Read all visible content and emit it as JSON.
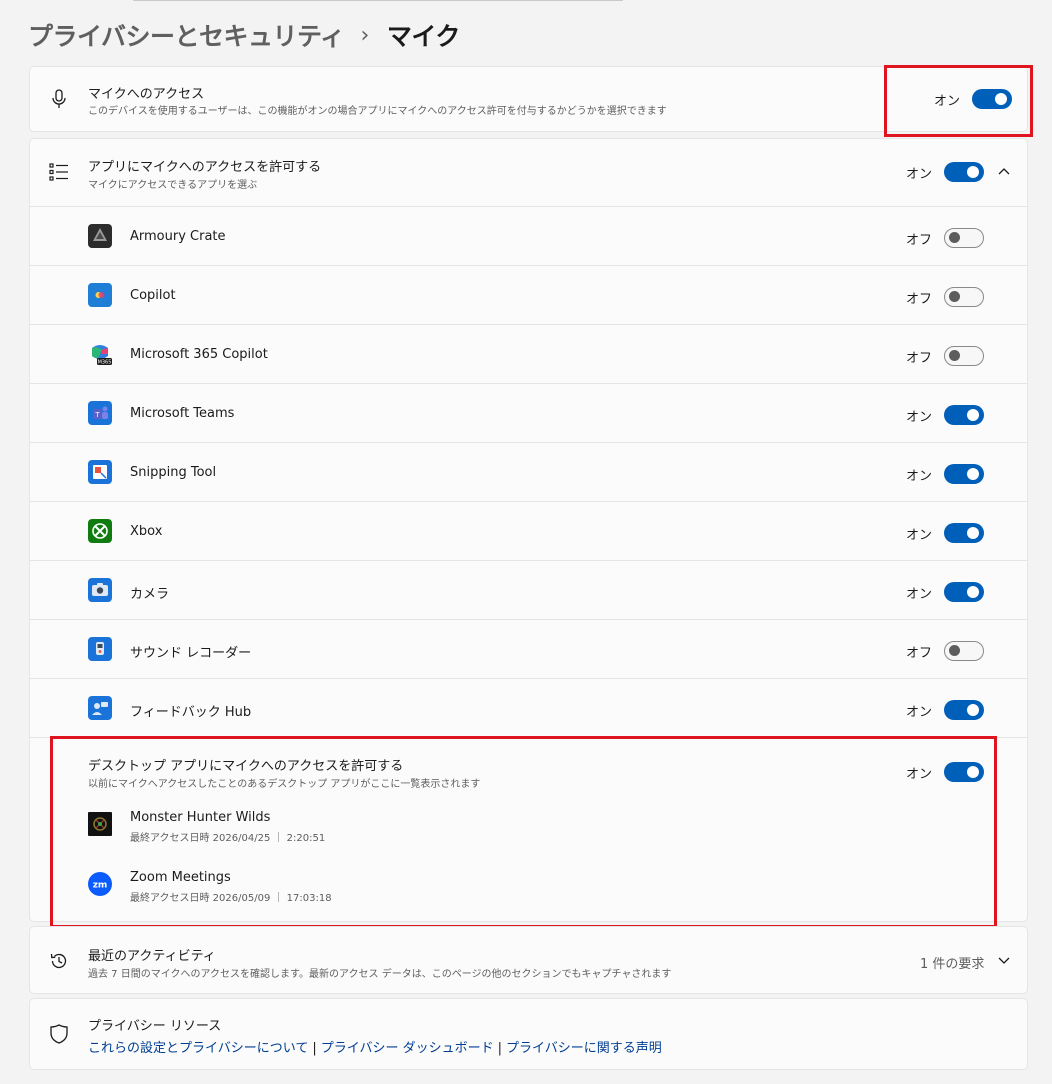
{
  "breadcrumb": {
    "parent": "プライバシーとセキュリティ",
    "separator": "›",
    "current": "マイク"
  },
  "mic_access": {
    "title": "マイクへのアクセス",
    "description": "このデバイスを使用するユーザーは、この機能がオンの場合アプリにマイクへのアクセス許可を付与するかどうかを選択できます",
    "state": "オン",
    "enabled": true,
    "icon": "microphone-icon"
  },
  "app_access": {
    "title": "アプリにマイクへのアクセスを許可する",
    "description": "マイクにアクセスできるアプリを選ぶ",
    "state": "オン",
    "enabled": true,
    "icon": "list-icon",
    "expanded": true
  },
  "apps": [
    {
      "name": "Armoury Crate",
      "state": "オフ",
      "enabled": false,
      "icon": "armoury-crate-icon"
    },
    {
      "name": "Copilot",
      "state": "オフ",
      "enabled": false,
      "icon": "copilot-icon"
    },
    {
      "name": "Microsoft 365 Copilot",
      "state": "オフ",
      "enabled": false,
      "icon": "microsoft-365-copilot-icon"
    },
    {
      "name": "Microsoft Teams",
      "state": "オン",
      "enabled": true,
      "icon": "teams-icon"
    },
    {
      "name": "Snipping Tool",
      "state": "オン",
      "enabled": true,
      "icon": "snipping-tool-icon"
    },
    {
      "name": "Xbox",
      "state": "オン",
      "enabled": true,
      "icon": "xbox-icon"
    },
    {
      "name": "カメラ",
      "state": "オン",
      "enabled": true,
      "icon": "camera-icon"
    },
    {
      "name": "サウンド レコーダー",
      "state": "オフ",
      "enabled": false,
      "icon": "sound-recorder-icon"
    },
    {
      "name": "フィードバック Hub",
      "state": "オン",
      "enabled": true,
      "icon": "feedback-hub-icon"
    }
  ],
  "desktop_access": {
    "title": "デスクトップ アプリにマイクへのアクセスを許可する",
    "description": "以前にマイクへアクセスしたことのあるデスクトップ アプリがここに一覧表示されます",
    "state": "オン",
    "enabled": true,
    "apps": [
      {
        "name": "Monster Hunter Wilds",
        "last_access": "最終アクセス日時 2026/04/25 ｜ 2:20:51",
        "icon": "monster-hunter-wilds-icon"
      },
      {
        "name": "Zoom Meetings",
        "last_access": "最終アクセス日時 2026/05/09 ｜ 17:03:18",
        "icon": "zoom-icon"
      }
    ]
  },
  "recent_activity": {
    "title": "最近のアクティビティ",
    "description": "過去 7 日間のマイクへのアクセスを確認します。最新のアクセス データは、このページの他のセクションでもキャプチャされます",
    "count_label": "1 件の要求",
    "icon": "history-icon"
  },
  "privacy_resources": {
    "title": "プライバシー リソース",
    "icon": "shield-icon",
    "links": [
      "これらの設定とプライバシーについて",
      "プライバシー ダッシュボード",
      "プライバシーに関する声明"
    ],
    "separator": "|"
  },
  "colors": {
    "accent": "#005fb8",
    "highlight": "#e0141e",
    "link": "#003e92"
  }
}
